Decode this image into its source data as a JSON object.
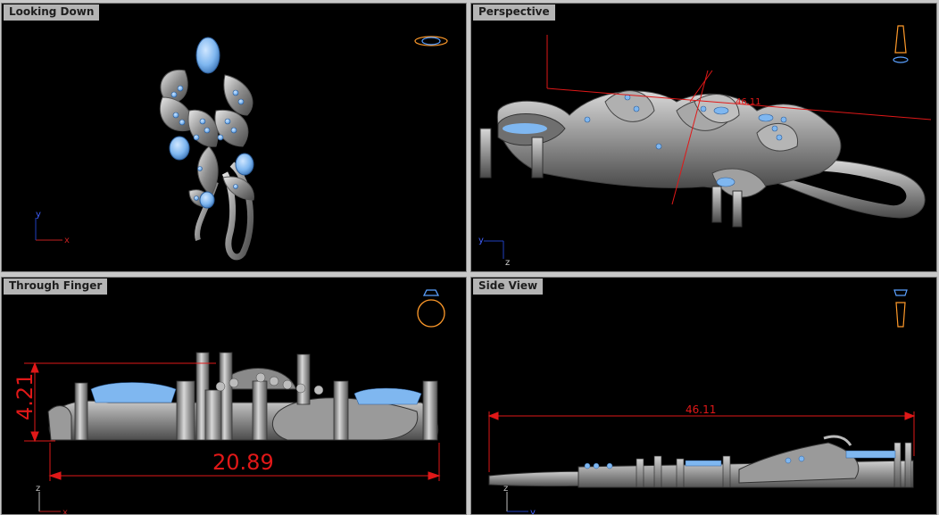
{
  "viewports": {
    "top_left": {
      "label": "Looking Down",
      "axis_x": "x",
      "axis_y": "y"
    },
    "top_right": {
      "label": "Perspective",
      "axis_x": "y",
      "axis_y": "z",
      "dimension": "46.11"
    },
    "bottom_left": {
      "label": "Through Finger",
      "axis_x": "x",
      "axis_y": "z",
      "height_dimension": "4.21",
      "width_dimension": "20.89"
    },
    "bottom_right": {
      "label": "Side View",
      "axis_x": "y",
      "axis_y": "z",
      "width_dimension": "46.11"
    }
  },
  "colors": {
    "background": "#000000",
    "metal": "#9a9a9a",
    "gem": "#7fb7f0",
    "dimension": "#e01818",
    "label_bg": "#b4b4b4"
  }
}
